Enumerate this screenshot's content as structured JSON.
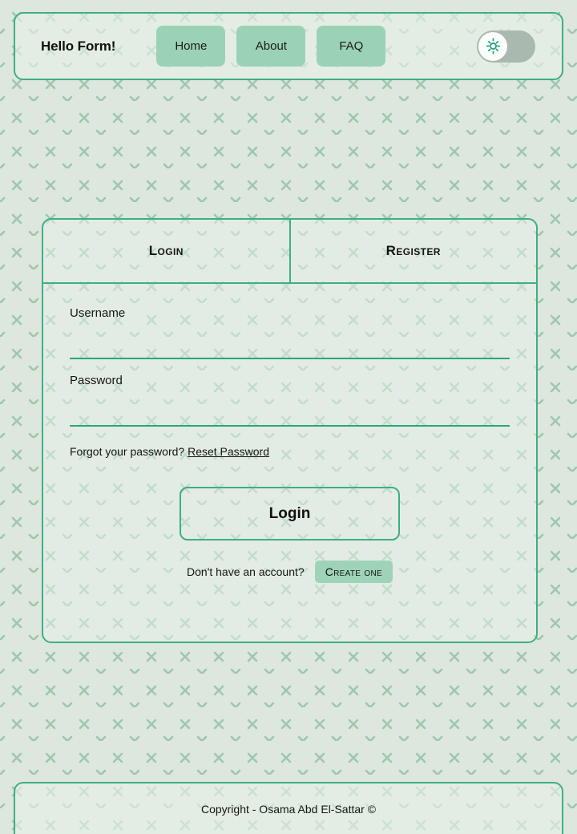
{
  "header": {
    "brand": "Hello Form!",
    "nav_items": [
      {
        "label": "Home"
      },
      {
        "label": "About"
      },
      {
        "label": "FAQ"
      }
    ],
    "theme_toggle": {
      "icon": "sun-icon",
      "state": "light",
      "knob_position": "left"
    }
  },
  "form": {
    "tabs": [
      {
        "label": "Login",
        "active": true
      },
      {
        "label": "Register",
        "active": false
      }
    ],
    "fields": [
      {
        "label": "Username",
        "value": "",
        "placeholder": "",
        "type": "text"
      },
      {
        "label": "Password",
        "value": "",
        "placeholder": "",
        "type": "password"
      }
    ],
    "forgot_text": "Forgot your password?",
    "reset_link": "Reset Password",
    "submit_label": "Login",
    "signup_text": "Don't have an account?",
    "create_label": "Create one"
  },
  "footer": {
    "copyright": "Copyright - Osama Abd El-Sattar ©"
  },
  "theme": {
    "page_background": "#dde7de",
    "pattern_mark": "#9ec7ae",
    "accent_border": "#3fae84",
    "input_underline": "#2aa678",
    "nav_button": "#9bd2b6",
    "toggle_track": "#a9b9af",
    "toggle_knob": "#fbfdfb",
    "panel_fill": "#e9f1e9",
    "text": "#151515"
  }
}
